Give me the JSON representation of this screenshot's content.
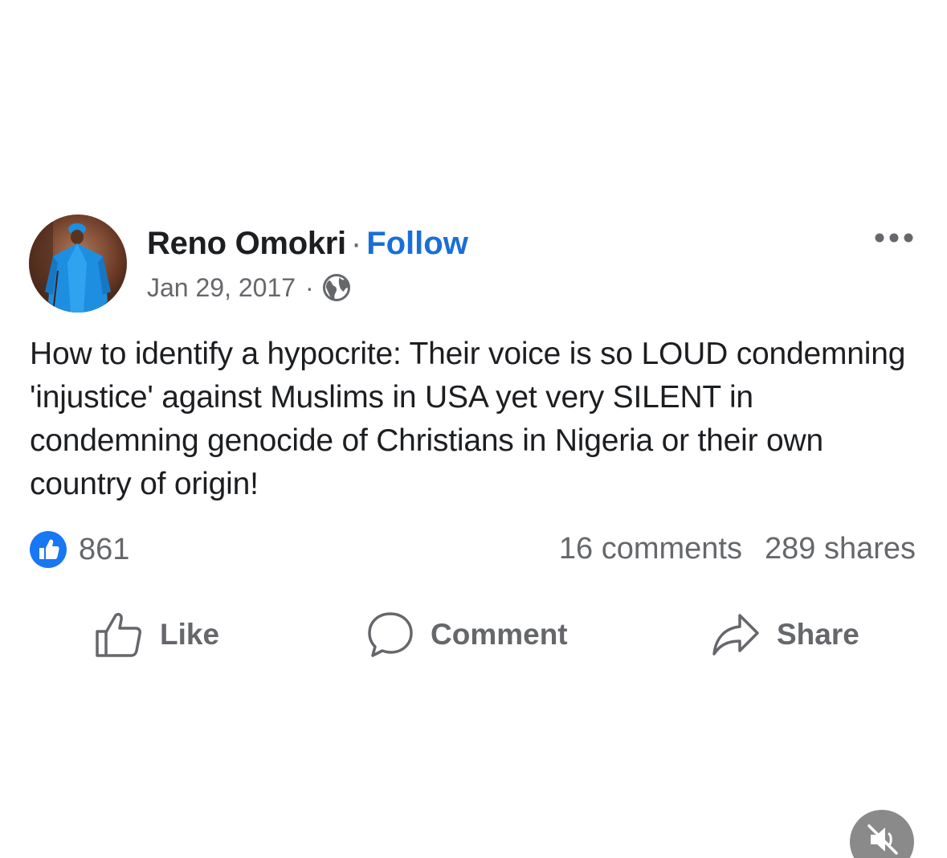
{
  "post": {
    "author": {
      "name": "Reno Omokri",
      "follow_label": "Follow",
      "avatar_icon": "person-in-blue-agbada-avatar"
    },
    "separator": "·",
    "date": "Jan 29, 2017",
    "privacy_icon": "globe-icon",
    "menu_icon": "more-options-icon",
    "body": "How to identify a hypocrite: Their voice is so LOUD condemning 'injustice' against Muslims in USA yet very SILENT in condemning genocide of Christians in Nigeria or their own country of origin!",
    "reactions": {
      "icon": "like-reaction-icon",
      "count": "861"
    },
    "comments_label": "16 comments",
    "shares_label": "289 shares"
  },
  "actions": {
    "like": {
      "label": "Like",
      "icon": "thumbs-up-icon"
    },
    "comment": {
      "label": "Comment",
      "icon": "speech-bubble-icon"
    },
    "share": {
      "label": "Share",
      "icon": "share-arrow-icon"
    }
  },
  "overlay": {
    "mute_icon": "speaker-muted-icon"
  },
  "colors": {
    "link": "#1a6fd6",
    "secondary_text": "#65676b",
    "primary_text": "#1c1e21",
    "reaction_blue": "#1877f2",
    "avatar_outfit": "#1e8fe0"
  }
}
